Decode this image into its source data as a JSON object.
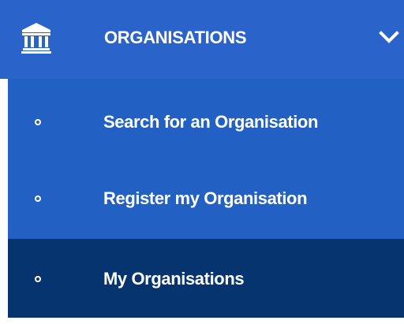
{
  "menu": {
    "header": {
      "label": "ORGANISATIONS",
      "icon": "institution-icon",
      "toggle_icon": "chevron-down-icon",
      "expanded": true
    },
    "items": [
      {
        "label": "Search for an Organisation",
        "icon": "circle-outline-icon",
        "active": false
      },
      {
        "label": "Register my Organisation",
        "icon": "circle-outline-icon",
        "active": false
      },
      {
        "label": "My Organisations",
        "icon": "circle-outline-icon",
        "active": true
      }
    ]
  },
  "colors": {
    "header_bg": "#2a63c9",
    "submenu_bg": "#2261c3",
    "active_item_bg": "#06346e",
    "text": "#ffffff",
    "page_bg": "#ffffff"
  }
}
